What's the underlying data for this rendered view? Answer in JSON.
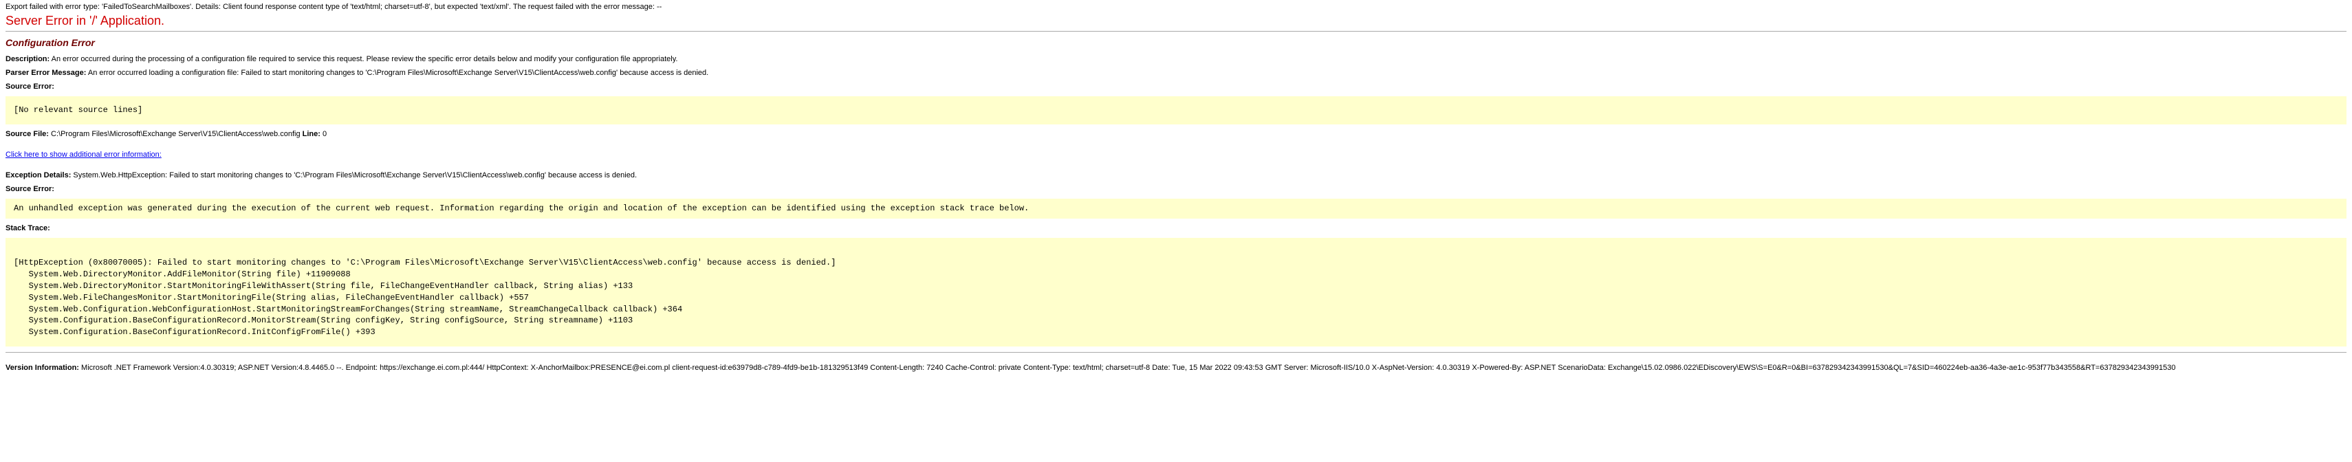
{
  "top_error": "Export failed with error type: 'FailedToSearchMailboxes'. Details: Client found response content type of 'text/html; charset=utf-8', but expected 'text/xml'. The request failed with the error message: --",
  "main_title": "Server Error in '/' Application.",
  "sub_title": "Configuration Error",
  "description": {
    "label": "Description:",
    "text": " An error occurred during the processing of a configuration file required to service this request. Please review the specific error details below and modify your configuration file appropriately."
  },
  "parser": {
    "label": "Parser Error Message:",
    "text": " An error occurred loading a configuration file: Failed to start monitoring changes to 'C:\\Program Files\\Microsoft\\Exchange Server\\V15\\ClientAccess\\web.config' because access is denied."
  },
  "source_error_label": "Source Error:",
  "source_error_block": "[No relevant source lines]",
  "source_file": {
    "label": "Source File:",
    "text": " C:\\Program Files\\Microsoft\\Exchange Server\\V15\\ClientAccess\\web.config",
    "line_label": "    Line:",
    "line_value": " 0"
  },
  "additional_link": "Click here to show additional error information:",
  "exception_details": {
    "label": "Exception Details:",
    "text": " System.Web.HttpException: Failed to start monitoring changes to 'C:\\Program Files\\Microsoft\\Exchange Server\\V15\\ClientAccess\\web.config' because access is denied."
  },
  "source_error2_label": "Source Error:",
  "source_error2_block": "An unhandled exception was generated during the execution of the current web request. Information regarding the origin and location of the exception can be identified using the exception stack trace below.",
  "stack_trace_label": "Stack Trace:",
  "stack_trace_block": "\n[HttpException (0x80070005): Failed to start monitoring changes to 'C:\\Program Files\\Microsoft\\Exchange Server\\V15\\ClientAccess\\web.config' because access is denied.]\n   System.Web.DirectoryMonitor.AddFileMonitor(String file) +11909088\n   System.Web.DirectoryMonitor.StartMonitoringFileWithAssert(String file, FileChangeEventHandler callback, String alias) +133\n   System.Web.FileChangesMonitor.StartMonitoringFile(String alias, FileChangeEventHandler callback) +557\n   System.Web.Configuration.WebConfigurationHost.StartMonitoringStreamForChanges(String streamName, StreamChangeCallback callback) +364\n   System.Configuration.BaseConfigurationRecord.MonitorStream(String configKey, String configSource, String streamname) +1103\n   System.Configuration.BaseConfigurationRecord.InitConfigFromFile() +393\n",
  "version": {
    "label": "Version Information:",
    "text": " Microsoft .NET Framework Version:4.0.30319; ASP.NET Version:4.8.4465.0 --. Endpoint: https://exchange.ei.com.pl:444/ HttpContext: X-AnchorMailbox:PRESENCE@ei.com.pl client-request-id:e63979d8-c789-4fd9-be1b-181329513f49 Content-Length: 7240 Cache-Control: private Content-Type: text/html; charset=utf-8 Date: Tue, 15 Mar 2022 09:43:53 GMT Server: Microsoft-IIS/10.0 X-AspNet-Version: 4.0.30319 X-Powered-By: ASP.NET ScenarioData: Exchange\\15.02.0986.022\\EDiscovery\\EWS\\S=E0&R=0&BI=637829342343991530&QL=7&SID=460224eb-aa36-4a3e-ae1c-953f77b343558&RT=637829342343991530"
  }
}
